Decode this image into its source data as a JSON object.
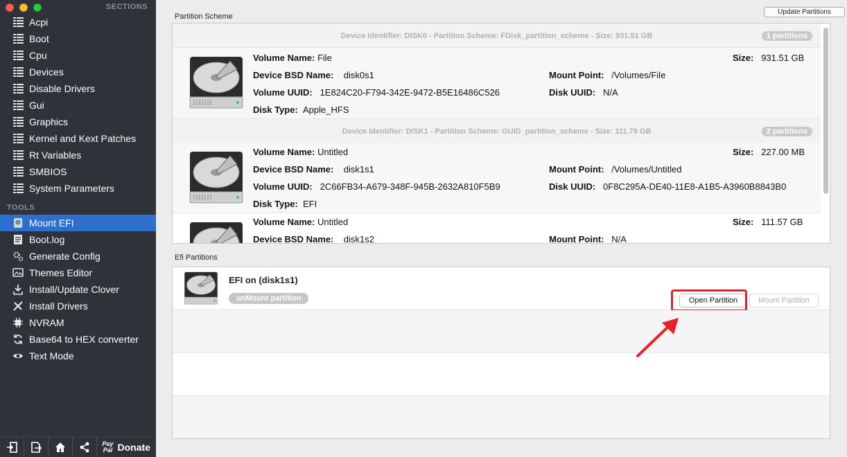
{
  "sidebar": {
    "sections_heading": "SECTIONS",
    "tools_heading": "TOOLS",
    "sections": [
      {
        "label": "Acpi"
      },
      {
        "label": "Boot"
      },
      {
        "label": "Cpu"
      },
      {
        "label": "Devices"
      },
      {
        "label": "Disable Drivers"
      },
      {
        "label": "Gui"
      },
      {
        "label": "Graphics"
      },
      {
        "label": "Kernel and Kext Patches"
      },
      {
        "label": "Rt Variables"
      },
      {
        "label": "SMBIOS"
      },
      {
        "label": "System Parameters"
      }
    ],
    "tools": [
      {
        "label": "Mount EFI",
        "icon": "disk-icon",
        "active": true
      },
      {
        "label": "Boot.log",
        "icon": "log-icon"
      },
      {
        "label": "Generate Config",
        "icon": "gears-icon"
      },
      {
        "label": "Themes Editor",
        "icon": "themes-icon"
      },
      {
        "label": "Install/Update Clover",
        "icon": "download-icon"
      },
      {
        "label": "Install Drivers",
        "icon": "tools-icon"
      },
      {
        "label": "NVRAM",
        "icon": "chip-icon"
      },
      {
        "label": "Base64 to HEX converter",
        "icon": "convert-icon"
      },
      {
        "label": "Text Mode",
        "icon": "eye-icon"
      }
    ],
    "bottom": {
      "paypal_line1": "Pay",
      "paypal_line2": "Pal",
      "donate": "Donate"
    }
  },
  "main": {
    "scheme_title": "Partition Scheme",
    "update_button": "Update Partitions",
    "efi_title": "Efi Partitions",
    "labels": {
      "volume_name": "Volume Name:",
      "device_bsd_name": "Device BSD Name:",
      "volume_uuid": "Volume UUID:",
      "disk_type": "Disk Type:",
      "size": "Size:",
      "mount_point": "Mount Point:",
      "disk_uuid": "Disk UUID:"
    },
    "devices": [
      {
        "header": "Device Identifier: DISK0 - Partition Scheme: FDisk_partition_scheme - Size: 931.51 GB",
        "badge": "1 partitions",
        "volumes": [
          {
            "volume_name": "File",
            "bsd_name": "disk0s1",
            "volume_uuid": "1E824C20-F794-342E-9472-B5E16486C526",
            "disk_type": "Apple_HFS",
            "size": "931.51 GB",
            "mount_point": "/Volumes/File",
            "disk_uuid": "N/A"
          }
        ]
      },
      {
        "header": "Device Identifier: DISK1 - Partition Scheme: GUID_partition_scheme - Size: 111.79 GB",
        "badge": "2 partitions",
        "volumes": [
          {
            "volume_name": "Untitled",
            "bsd_name": "disk1s1",
            "volume_uuid": "2C66FB34-A679-348F-945B-2632A810F5B9",
            "disk_type": "EFI",
            "size": "227.00 MB",
            "mount_point": "/Volumes/Untitled",
            "disk_uuid": "0F8C295A-DE40-11E8-A1B5-A3960B8843B0"
          },
          {
            "volume_name": "Untitled",
            "bsd_name": "disk1s2",
            "size": "111.57 GB",
            "mount_point": "N/A"
          }
        ]
      }
    ],
    "efi": {
      "title": "EFI on  (disk1s1)",
      "unmount": "unMount partition",
      "open_button": "Open Partition",
      "mount_button": "Mount Partition"
    }
  },
  "colors": {
    "sidebar_bg": "#2f3238",
    "active_item": "#2c6fcc",
    "highlight": "#e0242c"
  }
}
